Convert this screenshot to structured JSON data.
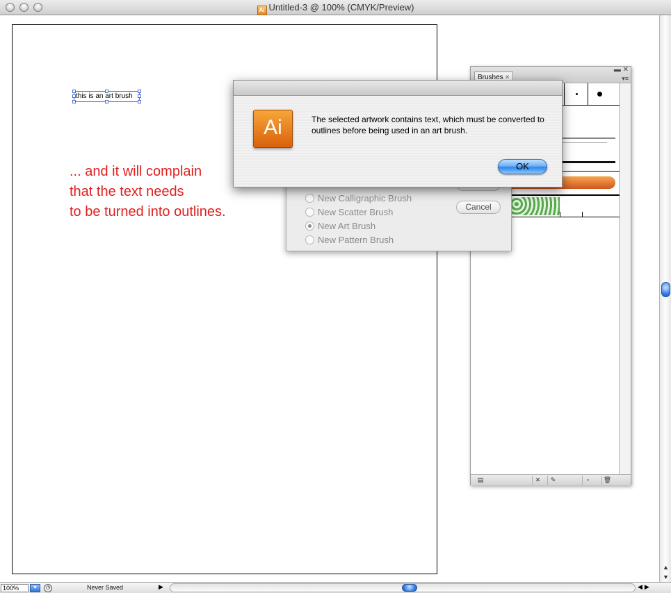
{
  "window": {
    "title": "Untitled-3 @ 100% (CMYK/Preview)"
  },
  "canvas": {
    "selected_text": "this is an art brush",
    "annotation_lines": [
      "... and it will complain",
      "that the text needs",
      "to be turned into outlines."
    ],
    "annotation_color": "#e01e1e"
  },
  "brushes_panel": {
    "tab_label": "Brushes",
    "tab_close": "×"
  },
  "new_brush_dialog": {
    "options": [
      {
        "label": "New Calligraphic Brush",
        "selected": false
      },
      {
        "label": "New Scatter Brush",
        "selected": false
      },
      {
        "label": "New Art Brush",
        "selected": true
      },
      {
        "label": "New Pattern Brush",
        "selected": false
      }
    ],
    "cancel_label": "Cancel",
    "ok_label": "OK"
  },
  "alert": {
    "message": "The selected artwork contains text, which must be converted to outlines before being used in an art brush.",
    "ok_label": "OK",
    "icon_label": "Ai",
    "icon_color": "#f08a1c"
  },
  "statusbar": {
    "zoom": "100%",
    "status_text": "Never Saved"
  }
}
